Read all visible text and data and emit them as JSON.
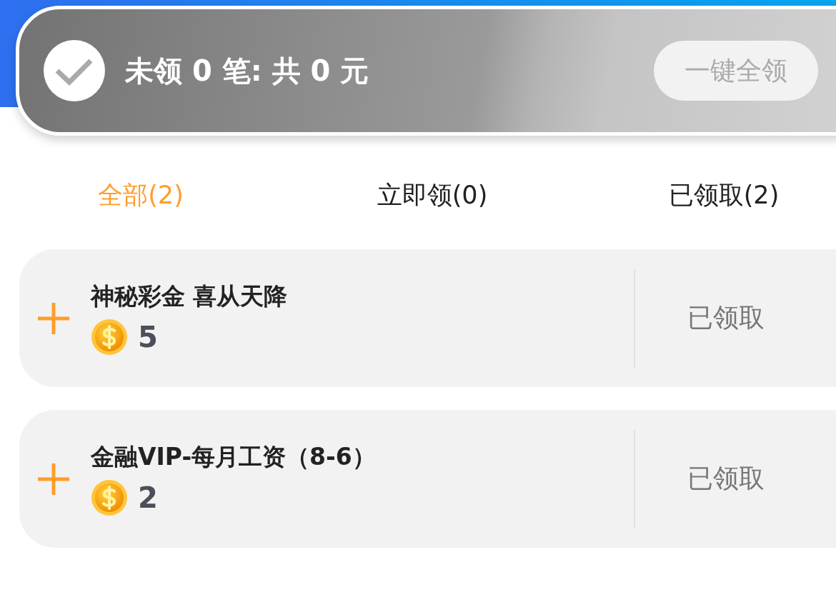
{
  "summary": {
    "text": "未领 0 笔: 共 0 元",
    "claim_all_button": {
      "label": "一键全领",
      "disabled": true
    }
  },
  "tabs": [
    {
      "label": "全部(2)",
      "selected": true
    },
    {
      "label": "立即领(0)",
      "selected": false
    },
    {
      "label": "已领取(2)",
      "selected": false
    }
  ],
  "rewards": [
    {
      "title": "神秘彩金 喜从天降",
      "amount": "5",
      "status": "已领取"
    },
    {
      "title": "金融VIP-每月工资（8-6）",
      "amount": "2",
      "status": "已领取"
    }
  ]
}
